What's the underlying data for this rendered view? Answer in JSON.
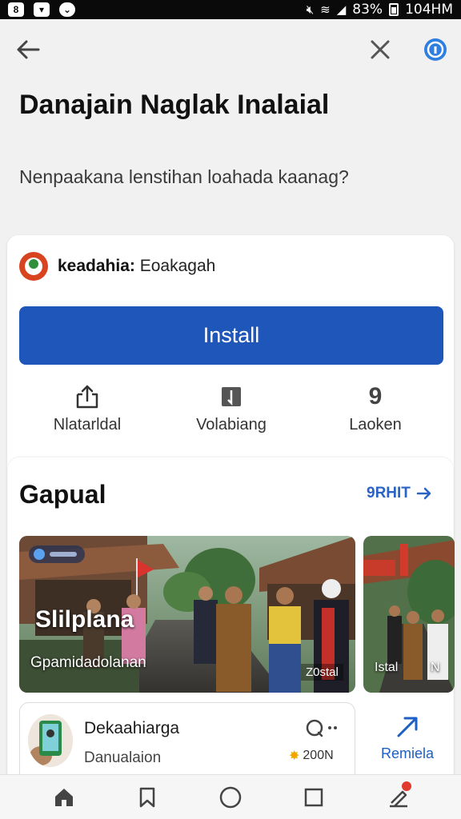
{
  "status_bar": {
    "battery_text": "83%",
    "time": "104HM"
  },
  "header": {
    "title": "Danajain Naglak Inalaial",
    "subtitle": "Nenpaakana lenstihan loahada kaanag?"
  },
  "app": {
    "name_bold": "keadahia:",
    "name_rest": " Eoakagah",
    "install_label": "Install",
    "accent_color": "#1f56b9"
  },
  "actions": [
    {
      "label": "Nlatarldal",
      "icon": "share-icon"
    },
    {
      "label": "Volabiang",
      "icon": "bookmark-icon"
    },
    {
      "label": "Laoken",
      "icon": "count-glyph",
      "glyph": "9"
    }
  ],
  "section": {
    "title": "Gapual",
    "link_label": "9RHIT"
  },
  "gallery": {
    "main": {
      "chip_text": "",
      "title": "Slilplana",
      "caption": "Gpamidadolanan",
      "badge": "Z0stal"
    },
    "side": {
      "caption_left": "Istal",
      "caption_right": "N"
    }
  },
  "item": {
    "name": "Dekaahiarga",
    "subtitle": "Danualaion",
    "rating": "200N"
  },
  "side_action": {
    "label": "Remiela"
  }
}
